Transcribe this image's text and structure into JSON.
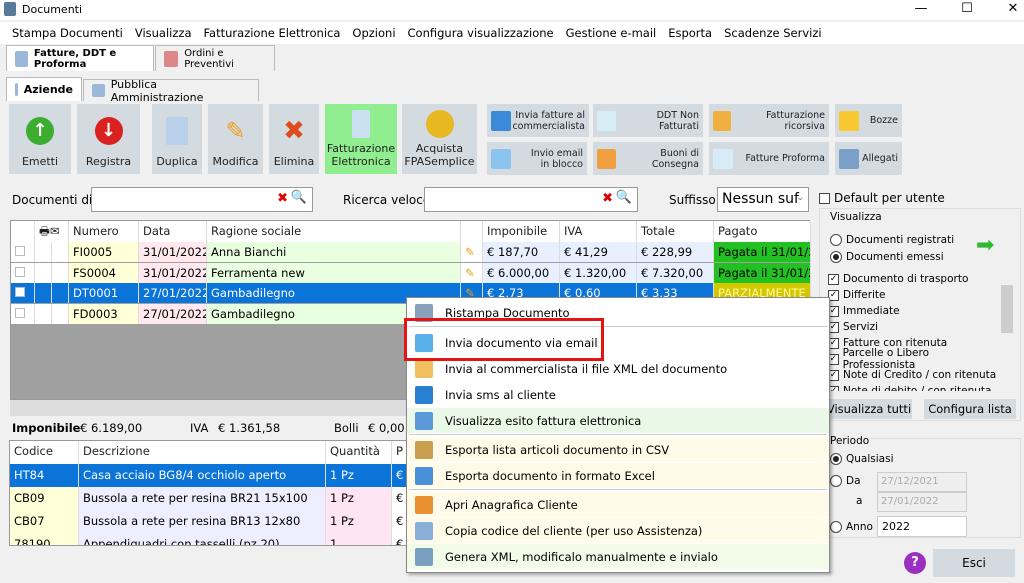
{
  "window": {
    "title": "Documenti",
    "minimize": "—",
    "maximize": "☐",
    "close": "✕"
  },
  "menu": [
    "Stampa Documenti",
    "Visualizza",
    "Fatturazione Elettronica",
    "Opzioni",
    "Configura visualizzazione",
    "Gestione e-mail",
    "Esporta",
    "Scadenze Servizi"
  ],
  "tabs": [
    {
      "label": "Fatture, DDT e Proforma"
    },
    {
      "label": "Ordini e Preventivi"
    }
  ],
  "subtabs": [
    {
      "label": "Aziende"
    },
    {
      "label": "Pubblica Amministrazione"
    }
  ],
  "toolbar": {
    "emetti": "Emetti",
    "registra": "Registra",
    "duplica": "Duplica",
    "modifica": "Modifica",
    "elimina": "Elimina",
    "fe1": "Fatturazione",
    "fe2": "Elettronica",
    "acq1": "Acquista",
    "acq2": "FPASemplice",
    "invia1": "Invia fatture al",
    "invia2": "commercialista",
    "email1": "Invio email",
    "email2": "in blocco",
    "ddt": "DDT Non Fatturati",
    "buoni": "Buoni di Consegna",
    "ricorsiva": "Fatturazione ricorsiva",
    "proforma": "Fatture Proforma",
    "bozze": "Bozze",
    "allegati": "Allegati"
  },
  "filters": {
    "documenti_di": "Documenti di",
    "ricerca": "Ricerca veloce",
    "suffisso": "Suffisso",
    "suffisso_value": "Nessun suf",
    "default_utente": "Default per utente"
  },
  "grid": {
    "headers": [
      "Numero",
      "Data",
      "Ragione sociale",
      "Imponibile",
      "IVA",
      "Totale",
      "Pagato"
    ],
    "rows": [
      {
        "numero": "FI0005",
        "data": "31/01/2022",
        "ragione": "Anna Bianchi",
        "imponibile": "€ 187,70",
        "iva": "€ 41,29",
        "totale": "€ 228,99",
        "pagato": "Pagata il 31/01/2"
      },
      {
        "numero": "FS0004",
        "data": "31/01/2022",
        "ragione": "Ferramenta new",
        "imponibile": "€ 6.000,00",
        "iva": "€ 1.320,00",
        "totale": "€ 7.320,00",
        "pagato": "Pagata il 31/01/2"
      },
      {
        "numero": "DT0001",
        "data": "27/01/2022",
        "ragione": "Gambadilegno",
        "imponibile": "€ 2,73",
        "iva": "€ 0,60",
        "totale": "€ 3,33",
        "pagato": "PARZIALMENTE P"
      },
      {
        "numero": "FD0003",
        "data": "27/01/2022",
        "ragione": "Gambadilegno",
        "imponibile": "",
        "iva": "",
        "totale": "",
        "pagato": ""
      }
    ]
  },
  "totals": {
    "imponibile_label": "Imponibile",
    "imponibile": "€ 6.189,00",
    "iva_label": "IVA",
    "iva": "€ 1.361,58",
    "bolli_label": "Bolli",
    "bolli": "€ 0,00"
  },
  "details": {
    "headers": [
      "Codice",
      "Descrizione",
      "Quantità",
      "P"
    ],
    "rows": [
      {
        "codice": "HT84",
        "descrizione": "Casa acciaio BG8/4 occhiolo aperto",
        "qta": "1 Pz",
        "p": "€"
      },
      {
        "codice": "CB09",
        "descrizione": "Bussola a rete per resina BR21  15x100",
        "qta": "1 Pz",
        "p": "€"
      },
      {
        "codice": "CB07",
        "descrizione": "Bussola a rete per resina BR13  12x80",
        "qta": "1 Pz",
        "p": "€"
      },
      {
        "codice": "78190",
        "descrizione": "Appendiquadri con tasselli (pz 20)",
        "qta": "1",
        "p": "€"
      }
    ]
  },
  "context_menu": [
    "Ristampa Documento",
    "Invia documento via email",
    "Invia al commercialista il file XML del documento",
    "Invia sms al cliente",
    "Visualizza esito fattura elettronica",
    "Esporta lista articoli documento in CSV",
    "Esporta documento in formato Excel",
    "Apri Anagrafica Cliente",
    "Copia codice del cliente (per uso Assistenza)",
    "Genera XML, modificalo manualmente e invialo"
  ],
  "visualizza": {
    "title": "Visualizza",
    "radio": [
      "Documenti registrati",
      "Documenti emessi"
    ],
    "checks": [
      "Documento di trasporto",
      "Differite",
      "Immediate",
      "Servizi",
      "Fatture con ritenuta",
      "Parcelle o Libero Professionista",
      "Note di Credito / con ritenuta",
      "Note di debito / con ritenuta"
    ],
    "tutti": "Visualizza tutti",
    "configura": "Configura lista"
  },
  "periodo": {
    "title": "Periodo",
    "qualsiasi": "Qualsiasi",
    "da": "Da",
    "a": "a",
    "da_value": "27/12/2021",
    "a_value": "27/01/2022",
    "anno": "Anno",
    "anno_value": "2022"
  },
  "esci": "Esci",
  "help": "?"
}
